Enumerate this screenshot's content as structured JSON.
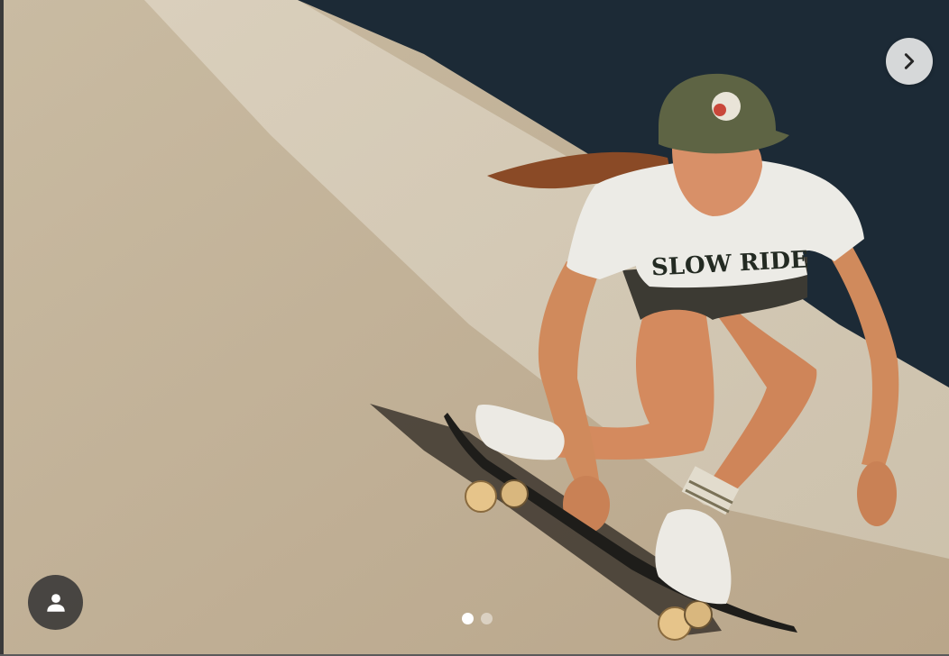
{
  "photo": {
    "shirt_text": "SLOW RIDE",
    "colors": {
      "concrete": "#cdbfa6",
      "water": "#1c2a36",
      "cap": "#5e6444",
      "shirt": "#ecebe6",
      "skin": "#d48a5e"
    }
  },
  "controls": {
    "next_icon": "chevron-right-icon",
    "tag_icon": "user-icon"
  },
  "carousel": {
    "total": 2,
    "active_index": 0
  }
}
